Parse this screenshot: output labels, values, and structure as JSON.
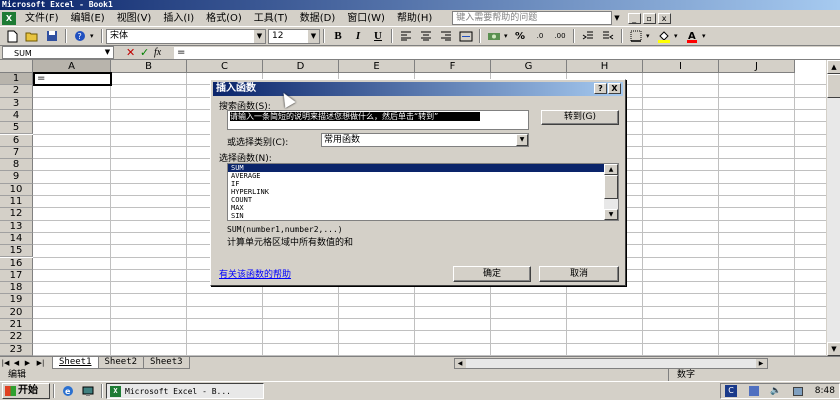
{
  "window": {
    "title": "Microsoft Excel - Book1",
    "help_placeholder": "键入需要帮助的问题",
    "min": "_",
    "restore": "▫",
    "close": "x"
  },
  "menu": {
    "items": [
      "文件(F)",
      "编辑(E)",
      "视图(V)",
      "插入(I)",
      "格式(O)",
      "工具(T)",
      "数据(D)",
      "窗口(W)",
      "帮助(H)"
    ]
  },
  "toolbar": {
    "font_name": "宋体",
    "font_size": "12",
    "bold": "B",
    "italic": "I",
    "underline": "U",
    "percent": "%"
  },
  "formula": {
    "name_box": "SUM",
    "cancel": "✕",
    "enter": "✓",
    "fx": "fx",
    "content": "="
  },
  "grid": {
    "columns": [
      "A",
      "B",
      "C",
      "D",
      "E",
      "F",
      "G",
      "H",
      "I",
      "J"
    ],
    "rows": [
      "1",
      "2",
      "3",
      "4",
      "5",
      "6",
      "7",
      "8",
      "9",
      "10",
      "11",
      "12",
      "13",
      "14",
      "15",
      "16",
      "17",
      "18",
      "19",
      "20",
      "21",
      "22",
      "23"
    ],
    "cell_a1": "="
  },
  "sheets": {
    "tabs": [
      "Sheet1",
      "Sheet2",
      "Sheet3"
    ],
    "active": "Sheet1"
  },
  "status": {
    "mode": "编辑",
    "indicator": "数字"
  },
  "taskbar": {
    "start": "开始",
    "task": "Microsoft Excel - B...",
    "clock": "8:48"
  },
  "dialog": {
    "title": "插入函数",
    "help_btn": "?",
    "close_btn": "X",
    "search_label": "搜索函数(S):",
    "search_value": "请输入一条简短的说明来描述您想做什么，然后单击“转到”",
    "go_button": "转到(G)",
    "category_label": "或选择类别(C):",
    "category_value": "常用函数",
    "select_label": "选择函数(N):",
    "functions": [
      "SUM",
      "AVERAGE",
      "IF",
      "HYPERLINK",
      "COUNT",
      "MAX",
      "SIN"
    ],
    "selected_function": "SUM",
    "syntax": "SUM(number1,number2,...)",
    "description": "计算单元格区域中所有数值的和",
    "help_link": "有关该函数的帮助",
    "ok_button": "确定",
    "cancel_button": "取消"
  }
}
